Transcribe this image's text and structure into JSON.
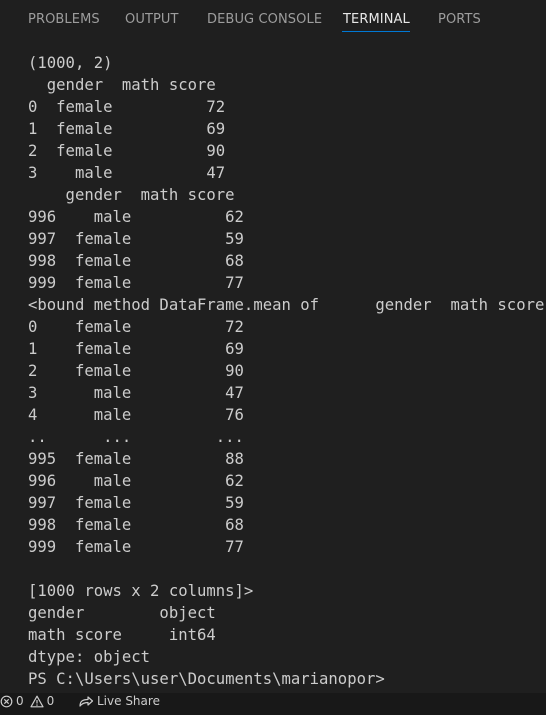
{
  "panel": {
    "tabs": [
      {
        "label": "PROBLEMS",
        "active": false
      },
      {
        "label": "OUTPUT",
        "active": false
      },
      {
        "label": "DEBUG CONSOLE",
        "active": false
      },
      {
        "label": "TERMINAL",
        "active": true
      },
      {
        "label": "PORTS",
        "active": false
      }
    ],
    "accent_color": "#0078d4"
  },
  "terminal": {
    "lines": [
      "(1000, 2)",
      "  gender  math score",
      "0  female          72",
      "1  female          69",
      "2  female          90",
      "3    male          47",
      "    gender  math score",
      "996    male          62",
      "997  female          59",
      "998  female          68",
      "999  female          77",
      "<bound method DataFrame.mean of      gender  math score",
      "0    female          72",
      "1    female          69",
      "2    female          90",
      "3      male          47",
      "4      male          76",
      "..      ...         ...",
      "995  female          88",
      "996    male          62",
      "997  female          59",
      "998  female          68",
      "999  female          77",
      "",
      "[1000 rows x 2 columns]>",
      "gender        object",
      "math score     int64",
      "dtype: object",
      "PS C:\\Users\\user\\Documents\\marianopor>"
    ]
  },
  "statusbar": {
    "errors_count": "0",
    "warnings_count": "0",
    "live_share_label": "Live Share"
  }
}
